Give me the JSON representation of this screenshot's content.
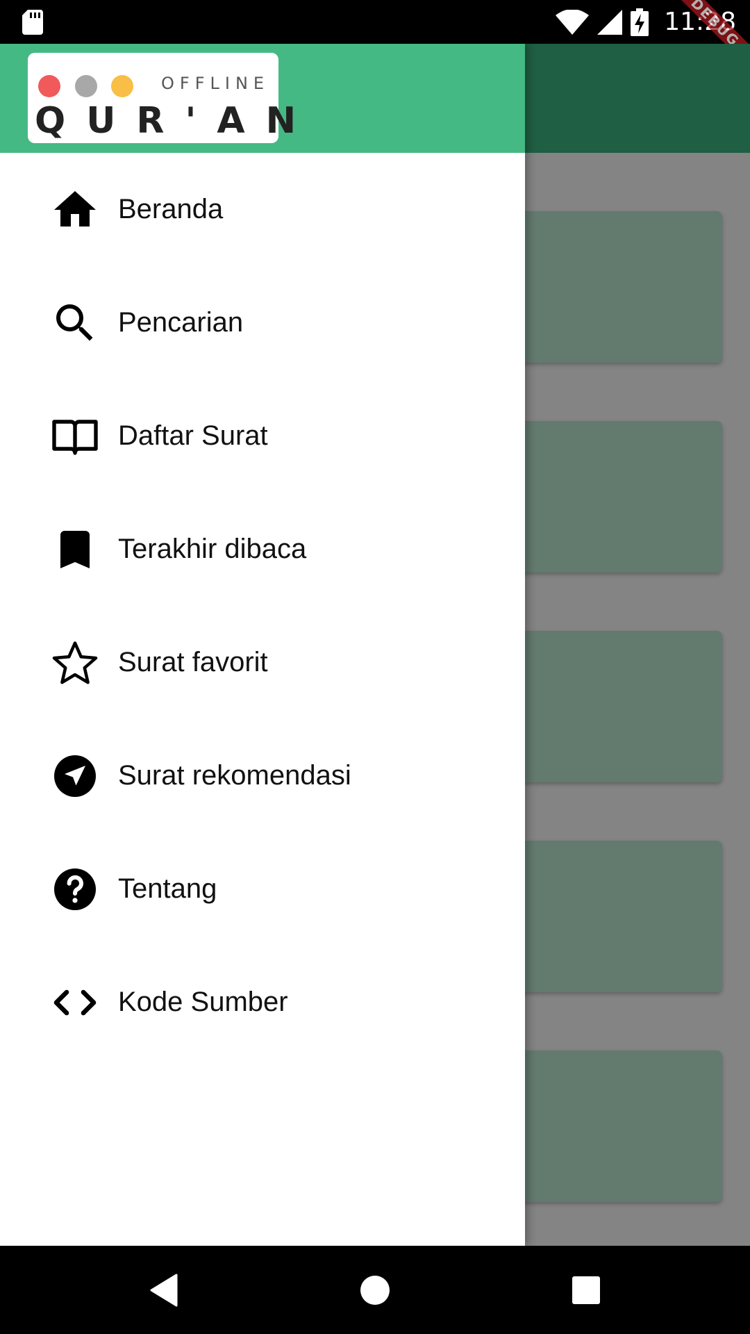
{
  "status_bar": {
    "time": "11:28",
    "icons": [
      "sd-card-icon",
      "wifi-icon",
      "cell-signal-icon",
      "battery-charging-icon"
    ]
  },
  "debug_banner": "DEBUG",
  "drawer": {
    "logo": {
      "top_text": "OFFLINE",
      "main_text": "QUR'AN",
      "dot_colors": [
        "#f05a5a",
        "#a8a8a8",
        "#f8be45"
      ]
    },
    "items": [
      {
        "label": "Beranda",
        "icon": "home-icon"
      },
      {
        "label": "Pencarian",
        "icon": "search-icon"
      },
      {
        "label": "Daftar Surat",
        "icon": "book-open-icon"
      },
      {
        "label": "Terakhir dibaca",
        "icon": "bookmark-icon"
      },
      {
        "label": "Surat favorit",
        "icon": "star-outline-icon"
      },
      {
        "label": "Surat rekomendasi",
        "icon": "navigation-icon"
      },
      {
        "label": "Tentang",
        "icon": "help-circle-icon"
      },
      {
        "label": "Kode Sumber",
        "icon": "code-icon"
      }
    ]
  },
  "colors": {
    "drawer_header": "#45b984",
    "app_bar": "#1f5f43",
    "scrim": "#848484",
    "card": "#637a6e"
  },
  "nav_bar": {
    "buttons": [
      "back-icon",
      "home-circle-icon",
      "recents-icon"
    ]
  }
}
